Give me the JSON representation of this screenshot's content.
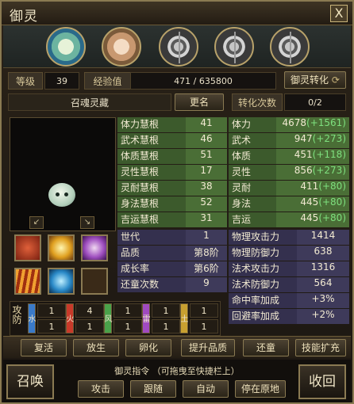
{
  "window": {
    "title": "御灵",
    "close_label": "X"
  },
  "header": {
    "level_label": "等级",
    "level_value": "39",
    "exp_label": "经验值",
    "exp_separator": "/",
    "exp_value": "471 / 635800",
    "transform_button": "御灵转化"
  },
  "summon": {
    "name": "召魂灵藏",
    "rename_button": "更名",
    "transform_count_label": "转化次数",
    "transform_count_value": "0/2"
  },
  "aptitude": [
    {
      "label": "体力慧根",
      "value": "41"
    },
    {
      "label": "武术慧根",
      "value": "46"
    },
    {
      "label": "体质慧根",
      "value": "51"
    },
    {
      "label": "灵性慧根",
      "value": "17"
    },
    {
      "label": "灵耐慧根",
      "value": "38"
    },
    {
      "label": "身法慧根",
      "value": "52"
    },
    {
      "label": "吉运慧根",
      "value": "31"
    }
  ],
  "attributes": [
    {
      "label": "体力",
      "value": "4678",
      "bonus": "(+1561)"
    },
    {
      "label": "武术",
      "value": "947",
      "bonus": "(+273)"
    },
    {
      "label": "体质",
      "value": "451",
      "bonus": "(+118)"
    },
    {
      "label": "灵性",
      "value": "856",
      "bonus": "(+273)"
    },
    {
      "label": "灵耐",
      "value": "411",
      "bonus": "(+80)"
    },
    {
      "label": "身法",
      "value": "445",
      "bonus": "(+80)"
    },
    {
      "label": "吉运",
      "value": "445",
      "bonus": "(+80)"
    }
  ],
  "info": [
    {
      "label": "世代",
      "value": "1"
    },
    {
      "label": "品质",
      "value": "第8阶"
    },
    {
      "label": "成长率",
      "value": "第6阶"
    },
    {
      "label": "还童次数",
      "value": "9"
    }
  ],
  "combat": [
    {
      "label": "物理攻击力",
      "value": "1414"
    },
    {
      "label": "物理防御力",
      "value": "638"
    },
    {
      "label": "法术攻击力",
      "value": "1316"
    },
    {
      "label": "法术防御力",
      "value": "564"
    },
    {
      "label": "命中率加成",
      "value": "+3%"
    },
    {
      "label": "回避率加成",
      "value": "+2%"
    }
  ],
  "elements": {
    "side_label": "攻防",
    "items": [
      {
        "name": "水",
        "attack": "1",
        "defense": "1",
        "color": "#3a7ac8"
      },
      {
        "name": "火",
        "attack": "4",
        "defense": "1",
        "color": "#c83a2a"
      },
      {
        "name": "风",
        "attack": "1",
        "defense": "1",
        "color": "#4aa24a"
      },
      {
        "name": "雷",
        "attack": "1",
        "defense": "1",
        "color": "#a04ac0"
      },
      {
        "name": "土",
        "attack": "1",
        "defense": "1",
        "color": "#c8a030"
      }
    ]
  },
  "actions": [
    "复活",
    "放生",
    "卵化",
    "提升品质",
    "还童",
    "技能扩充"
  ],
  "command": {
    "summon_button": "召唤",
    "hint": "御灵指令 （可拖曳至快捷栏上）",
    "buttons": [
      "攻击",
      "跟随",
      "自动",
      "停在原地"
    ],
    "recall_button": "收回"
  }
}
